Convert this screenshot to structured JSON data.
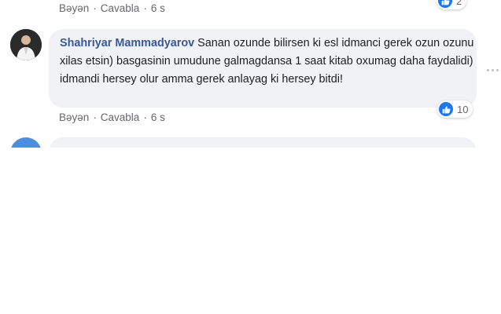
{
  "top_comment": {
    "like_action": "Bəyən",
    "reply_action": "Cavabla",
    "separator": "·",
    "time": "6 s",
    "reaction_count": "2"
  },
  "comment": {
    "author": "Shahriyar Mammadyarov",
    "text": "Sanan ozunde bilirsen ki esl idmanci gerek ozun ozunu xilas etsin) basgasinin umudune galmagdansa 1 saat kitab oxumag daha faydalidi) idmandi hersey olur amma gerek anlayag ki hersey bitdi!",
    "like_action": "Bəyən",
    "reply_action": "Cavabla",
    "separator": "·",
    "time": "6 s",
    "reaction_count": "10",
    "reaction_icon": "thumbs-up-icon",
    "more_icon": "more-options-icon"
  },
  "colors": {
    "author": "#385898",
    "bubble": "#f0f2f5",
    "meta": "#65676b",
    "like_blue": "#1877f2"
  }
}
